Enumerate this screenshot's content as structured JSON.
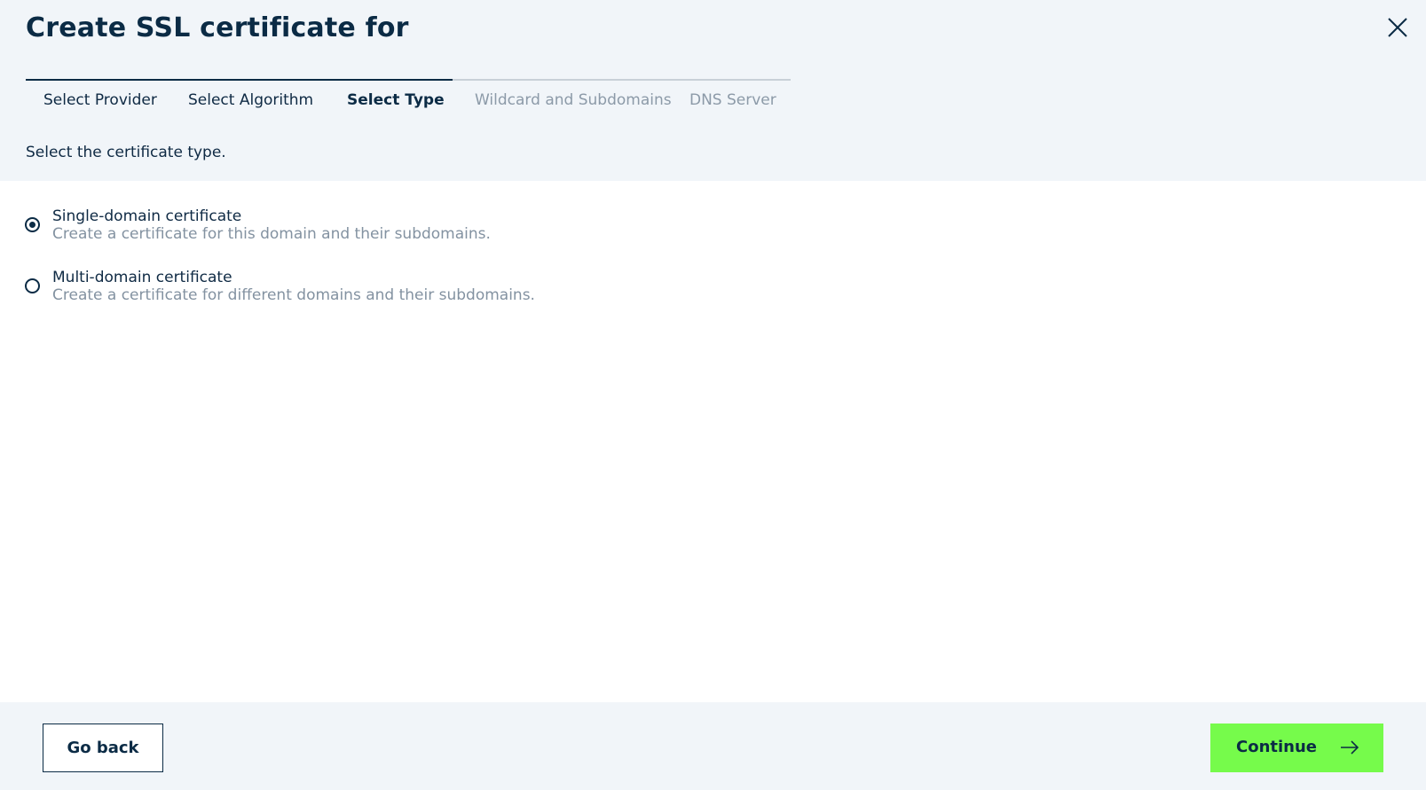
{
  "dialog": {
    "title": "Create SSL certificate for",
    "close_icon": "close-icon"
  },
  "stepper": {
    "steps": [
      {
        "label": "Select Provider",
        "state": "done"
      },
      {
        "label": "Select Algorithm",
        "state": "done"
      },
      {
        "label": "Select Type",
        "state": "active"
      },
      {
        "label": "Wildcard and Subdomains",
        "state": "future"
      },
      {
        "label": "DNS Server",
        "state": "future"
      }
    ]
  },
  "subtitle": "Select the certificate type.",
  "options": [
    {
      "label": "Single-domain certificate",
      "description": "Create a certificate for this domain and their subdomains.",
      "checked": true
    },
    {
      "label": "Multi-domain certificate",
      "description": "Create a certificate for different domains and their subdomains.",
      "checked": false
    }
  ],
  "footer": {
    "back_label": "Go back",
    "continue_label": "Continue",
    "continue_icon": "arrow-right-icon"
  },
  "colors": {
    "primary": "#0b2b45",
    "accent": "#76fb4b",
    "header_bg": "#f1f5f9",
    "muted_text": "#8392a1"
  }
}
